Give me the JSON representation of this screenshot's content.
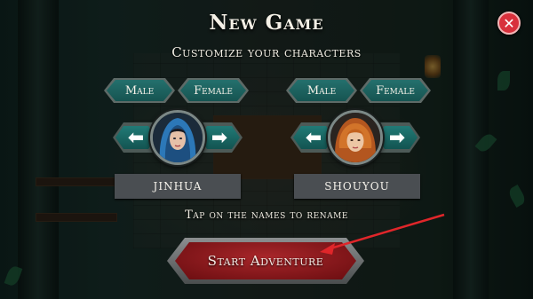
{
  "screen": {
    "title": "New Game",
    "subtitle": "Customize your characters",
    "hint": "Tap on the names to rename",
    "start_label": "Start Adventure"
  },
  "close_button": {
    "symbol": "✕",
    "icon": "close-icon"
  },
  "characters": [
    {
      "name": "JINHUA",
      "gender_options": [
        "Male",
        "Female"
      ],
      "prev_arrow": "⬅",
      "next_arrow": "➡",
      "portrait_icon": "hooded-woman-portrait"
    },
    {
      "name": "SHOUYOU",
      "gender_options": [
        "Male",
        "Female"
      ],
      "prev_arrow": "⬅",
      "next_arrow": "➡",
      "portrait_icon": "red-haired-woman-portrait"
    }
  ],
  "colors": {
    "teal_button": "#1d6663",
    "start_button": "#8a1a1e",
    "close_button": "#d8303c",
    "name_plate": "#4a4e52",
    "annotation_arrow": "#e0262a"
  }
}
